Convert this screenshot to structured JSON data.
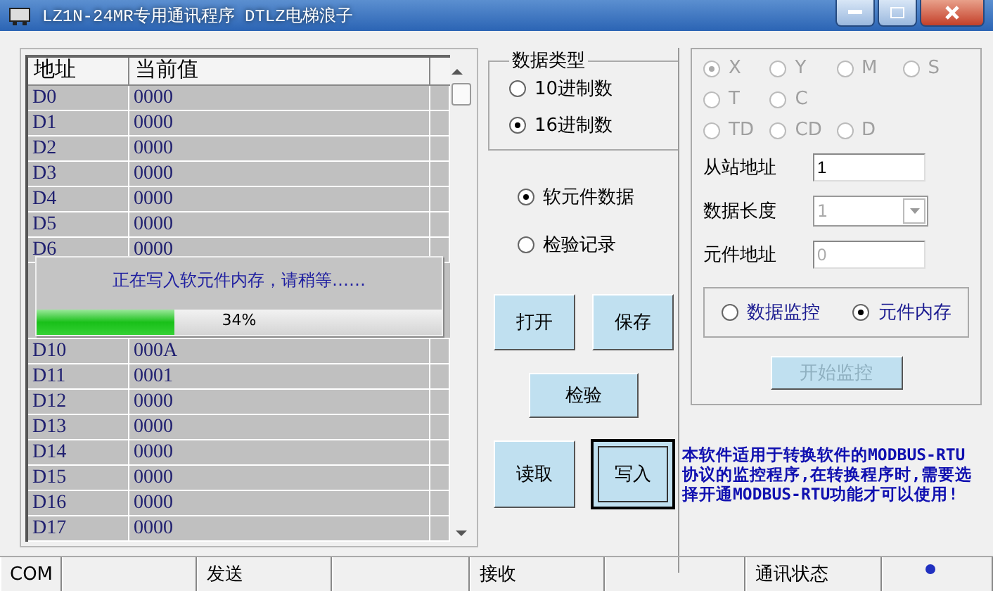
{
  "window": {
    "title": "LZ1N-24MR专用通讯程序 DTLZ电梯浪子"
  },
  "table": {
    "columns": [
      "地址",
      "当前值"
    ],
    "rows_top": [
      {
        "address": "D0",
        "value": "0000"
      },
      {
        "address": "D1",
        "value": "0000"
      },
      {
        "address": "D2",
        "value": "0000"
      },
      {
        "address": "D3",
        "value": "0000"
      },
      {
        "address": "D4",
        "value": "0000"
      },
      {
        "address": "D5",
        "value": "0000"
      },
      {
        "address": "D6",
        "value": "0000"
      }
    ],
    "rows_bottom": [
      {
        "address": "D10",
        "value": "000A"
      },
      {
        "address": "D11",
        "value": "0001"
      },
      {
        "address": "D12",
        "value": "0000"
      },
      {
        "address": "D13",
        "value": "0000"
      },
      {
        "address": "D14",
        "value": "0000"
      },
      {
        "address": "D15",
        "value": "0000"
      },
      {
        "address": "D16",
        "value": "0000"
      },
      {
        "address": "D17",
        "value": "0000"
      }
    ]
  },
  "progress_dialog": {
    "message": "正在写入软元件内存，请稍等……",
    "level": 0.34,
    "reading": "34%"
  },
  "data_type": {
    "title": "数据类型",
    "options": [
      {
        "label": "10进制数",
        "selected": false
      },
      {
        "label": "16进制数",
        "selected": true
      }
    ]
  },
  "source_options": [
    {
      "label": "软元件数据",
      "selected": true
    },
    {
      "label": "检验记录",
      "selected": false
    }
  ],
  "file_buttons": [
    {
      "label": "打开",
      "focused": false
    },
    {
      "label": "保存",
      "focused": false
    }
  ],
  "verify_button": {
    "label": "检验"
  },
  "io_buttons": [
    {
      "label": "读取",
      "focused": false
    },
    {
      "label": "写入",
      "focused": true
    }
  ],
  "element_types": {
    "disabled": true,
    "rows": [
      [
        {
          "label": "X",
          "selected": true
        },
        {
          "label": "Y",
          "selected": false
        },
        {
          "label": "M",
          "selected": false
        },
        {
          "label": "S",
          "selected": false
        }
      ],
      [
        {
          "label": "T",
          "selected": false
        },
        {
          "label": "C",
          "selected": false
        }
      ],
      [
        {
          "label": "TD",
          "selected": false
        },
        {
          "label": "CD",
          "selected": false
        },
        {
          "label": "D",
          "selected": false
        }
      ]
    ]
  },
  "fields": [
    {
      "label": "从站地址",
      "value": "1",
      "kind": "text",
      "disabled": false
    },
    {
      "label": "数据长度",
      "value": "1",
      "kind": "dropdown",
      "disabled": true
    },
    {
      "label": "元件地址",
      "value": "0",
      "kind": "text",
      "disabled": true
    }
  ],
  "mode_options": [
    {
      "label": "数据监控",
      "selected": false
    },
    {
      "label": "元件内存",
      "selected": true
    }
  ],
  "monitor_button": {
    "label": "开始监控",
    "disabled": true
  },
  "notice": "本软件适用于转换软件的MODBUS-RTU协议的监控程序,在转换程序时,需要选择开通MODBUS-RTU功能才可以使用!",
  "status_bar": [
    {
      "kind": "label",
      "text": "COM"
    },
    {
      "kind": "blank"
    },
    {
      "kind": "label",
      "text": "发送"
    },
    {
      "kind": "blank"
    },
    {
      "kind": "label",
      "text": "接收"
    },
    {
      "kind": "blank"
    },
    {
      "kind": "label",
      "text": "通讯状态"
    },
    {
      "kind": "indicator"
    }
  ]
}
